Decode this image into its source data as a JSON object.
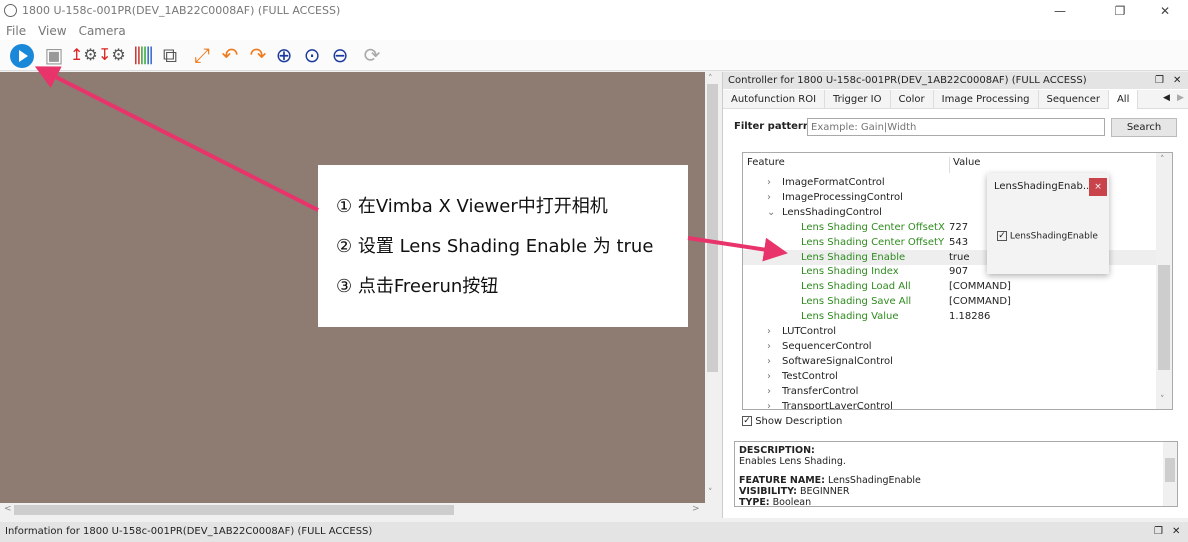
{
  "window": {
    "title": "1800 U-158c-001PR(DEV_1AB22C0008AF) (FULL ACCESS)",
    "minimize": "—",
    "maximize": "❐",
    "close": "✕"
  },
  "menu": [
    "File",
    "View",
    "Camera"
  ],
  "toolbar": {
    "icons": [
      "freerun-play-icon",
      "snapshot-icon",
      "load-settings-icon",
      "save-settings-icon",
      "histogram-icon",
      "open-window-icon",
      "fit-to-window-icon",
      "rotate-left-icon",
      "rotate-right-icon",
      "zoom-in-icon",
      "zoom-original-icon",
      "zoom-out-icon",
      "refresh-icon"
    ],
    "accent": "#1a88d8"
  },
  "controller": {
    "title": "Controller for 1800 U-158c-001PR(DEV_1AB22C0008AF) (FULL ACCESS)",
    "tabs": [
      "Autofunction ROI",
      "Trigger IO",
      "Color",
      "Image Processing",
      "Sequencer",
      "All"
    ],
    "active_tab": "All",
    "filter_label": "Filter pattern:",
    "filter_placeholder": "Example: Gain|Width",
    "filter_value": "",
    "search_label": "Search",
    "columns": [
      "Feature",
      "Value"
    ],
    "rows": [
      {
        "feature": "ImageFormatControl",
        "value": "",
        "level": 0,
        "expander": ">"
      },
      {
        "feature": "ImageProcessingControl",
        "value": "",
        "level": 0,
        "expander": ">"
      },
      {
        "feature": "LensShadingControl",
        "value": "",
        "level": 0,
        "expander": "v"
      },
      {
        "feature": "Lens Shading Center OffsetX",
        "value": "727",
        "level": 1,
        "expander": ""
      },
      {
        "feature": "Lens Shading Center OffsetY",
        "value": "543",
        "level": 1,
        "expander": ""
      },
      {
        "feature": "Lens Shading Enable",
        "value": "true",
        "level": 1,
        "expander": "",
        "selected": true
      },
      {
        "feature": "Lens Shading Index",
        "value": "907",
        "level": 1,
        "expander": ""
      },
      {
        "feature": "Lens Shading Load All",
        "value": "[COMMAND]",
        "level": 1,
        "expander": ""
      },
      {
        "feature": "Lens Shading Save All",
        "value": "[COMMAND]",
        "level": 1,
        "expander": ""
      },
      {
        "feature": "Lens Shading Value",
        "value": "1.18286",
        "level": 1,
        "expander": ""
      },
      {
        "feature": "LUTControl",
        "value": "",
        "level": 0,
        "expander": ">"
      },
      {
        "feature": "SequencerControl",
        "value": "",
        "level": 0,
        "expander": ">"
      },
      {
        "feature": "SoftwareSignalControl",
        "value": "",
        "level": 0,
        "expander": ">"
      },
      {
        "feature": "TestControl",
        "value": "",
        "level": 0,
        "expander": ">"
      },
      {
        "feature": "TransferControl",
        "value": "",
        "level": 0,
        "expander": ">"
      },
      {
        "feature": "TransportLayerControl",
        "value": "",
        "level": 0,
        "expander": ">"
      }
    ],
    "popup": {
      "title": "LensShadingEnab...",
      "close": "×",
      "checkbox_label": "LensShadingEnable",
      "checked": true
    },
    "show_description": {
      "label": "Show Description",
      "checked": true
    },
    "description": {
      "desc_key": "DESCRIPTION:",
      "desc_value": "Enables Lens Shading.",
      "name_key": "FEATURE NAME:",
      "name_value": "LensShadingEnable",
      "vis_key": "VISIBILITY:",
      "vis_value": "BEGINNER",
      "type_key": "TYPE:",
      "type_value": "Boolean"
    }
  },
  "info_bar": "Information for 1800 U-158c-001PR(DEV_1AB22C0008AF) (FULL ACCESS)",
  "callout": {
    "steps": [
      "① 在Vimba X Viewer中打开相机",
      "② 设置 Lens Shading Enable 为 true",
      "③ 点击Freerun按钮"
    ],
    "arrow_color": "#e8336b"
  }
}
